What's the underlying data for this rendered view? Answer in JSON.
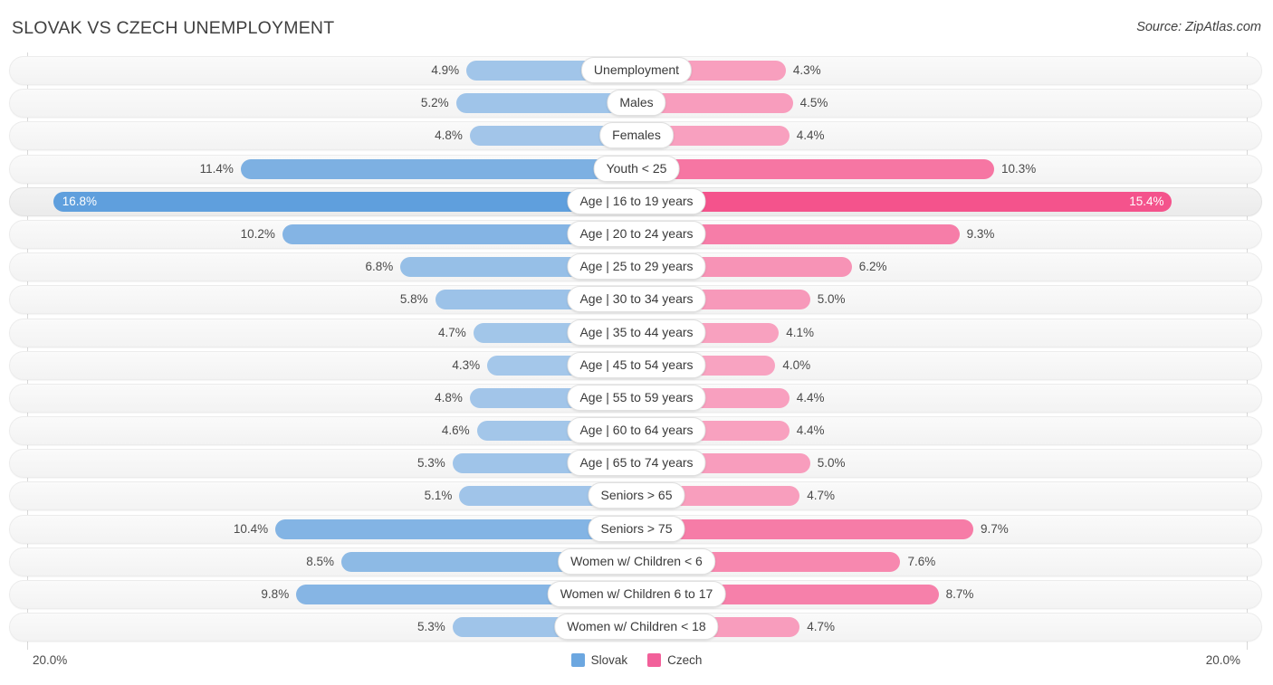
{
  "header": {
    "title": "SLOVAK VS CZECH UNEMPLOYMENT",
    "source": "Source: ZipAtlas.com"
  },
  "axis": {
    "left_label": "20.0%",
    "right_label": "20.0%",
    "max": 20.0
  },
  "legend": {
    "items": [
      {
        "label": "Slovak",
        "color": "#6ca7e0"
      },
      {
        "label": "Czech",
        "color": "#f2609a"
      }
    ]
  },
  "colors": {
    "slovak_light": "#a6c8ea",
    "slovak_mid": "#84b2e6",
    "slovak_dark": "#5f9fdd",
    "czech_light": "#f8a5c2",
    "czech_mid": "#f578a6",
    "czech_dark": "#f4538c",
    "row_bg": "#f7f7f7",
    "axis": "#d8d8d8"
  },
  "chart_data": {
    "type": "bar",
    "title": "SLOVAK VS CZECH UNEMPLOYMENT",
    "orientation": "horizontal-diverging",
    "xlabel": "",
    "ylabel": "",
    "xlim": [
      20.0,
      20.0
    ],
    "grid": false,
    "legend_position": "bottom-center",
    "categories": [
      "Unemployment",
      "Males",
      "Females",
      "Youth < 25",
      "Age | 16 to 19 years",
      "Age | 20 to 24 years",
      "Age | 25 to 29 years",
      "Age | 30 to 34 years",
      "Age | 35 to 44 years",
      "Age | 45 to 54 years",
      "Age | 55 to 59 years",
      "Age | 60 to 64 years",
      "Age | 65 to 74 years",
      "Seniors > 65",
      "Seniors > 75",
      "Women w/ Children < 6",
      "Women w/ Children 6 to 17",
      "Women w/ Children < 18"
    ],
    "series": [
      {
        "name": "Slovak",
        "color": "#7fb3e8",
        "values": [
          4.9,
          5.2,
          4.8,
          11.4,
          16.8,
          10.2,
          6.8,
          5.8,
          4.7,
          4.3,
          4.8,
          4.6,
          5.3,
          5.1,
          10.4,
          8.5,
          9.8,
          5.3
        ],
        "labels": [
          "4.9%",
          "5.2%",
          "4.8%",
          "11.4%",
          "16.8%",
          "10.2%",
          "6.8%",
          "5.8%",
          "4.7%",
          "4.3%",
          "4.8%",
          "4.6%",
          "5.3%",
          "5.1%",
          "10.4%",
          "8.5%",
          "9.8%",
          "5.3%"
        ]
      },
      {
        "name": "Czech",
        "color": "#f2609a",
        "values": [
          4.3,
          4.5,
          4.4,
          10.3,
          15.4,
          9.3,
          6.2,
          5.0,
          4.1,
          4.0,
          4.4,
          4.4,
          5.0,
          4.7,
          9.7,
          7.6,
          8.7,
          4.7
        ],
        "labels": [
          "4.3%",
          "4.5%",
          "4.4%",
          "10.3%",
          "15.4%",
          "9.3%",
          "6.2%",
          "5.0%",
          "4.1%",
          "4.0%",
          "4.4%",
          "4.4%",
          "5.0%",
          "4.7%",
          "9.7%",
          "7.6%",
          "8.7%",
          "4.7%"
        ]
      }
    ],
    "highlighted_row": "Age | 16 to 19 years"
  }
}
